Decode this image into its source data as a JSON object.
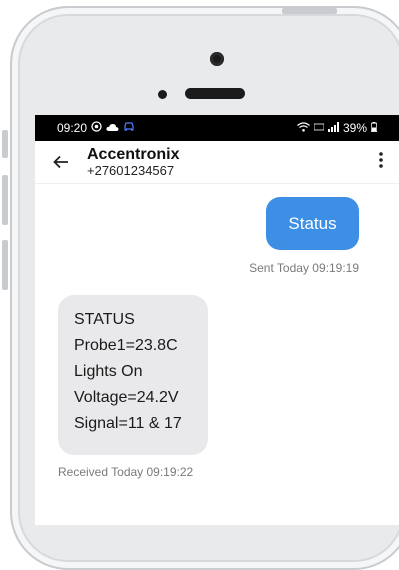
{
  "statusbar": {
    "time": "09:20",
    "left_icons": [
      "screen-record-icon",
      "cloud-icon",
      "car-icon"
    ],
    "right_label": "39%"
  },
  "conversation": {
    "contact_name": "Accentronix",
    "contact_number": "+27601234567"
  },
  "messages": {
    "sent_text": "Status",
    "sent_time": "Sent Today 09:19:19",
    "received_lines": [
      "STATUS",
      "Probe1=23.8C",
      "Lights On",
      "Voltage=24.2V",
      "Signal=11 & 17"
    ],
    "received_time": "Received Today 09:19:22"
  },
  "colors": {
    "sent_bubble": "#3d8ee5",
    "received_bubble": "#e9e9eb",
    "status_bar": "#000000"
  }
}
